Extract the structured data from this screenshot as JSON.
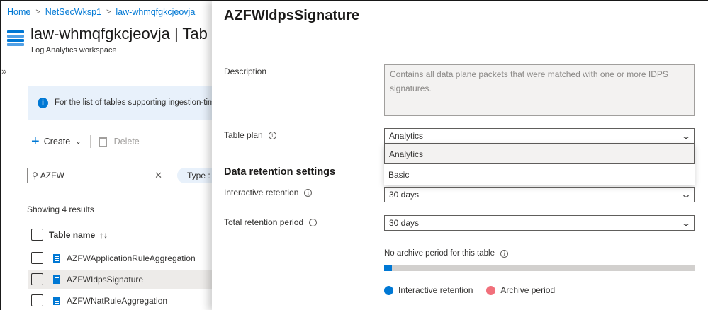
{
  "breadcrumb": {
    "items": [
      "Home",
      "NetSecWksp1",
      "law-whmqfgkcjeovja"
    ],
    "separator": ">"
  },
  "workspace": {
    "title": "law-whmqfgkcjeovja | Tab",
    "subtitle": "Log Analytics workspace",
    "icon": "log-analytics-icon"
  },
  "collapse_glyph": "»",
  "info_banner": {
    "text": "For the list of tables supporting ingestion-time",
    "icon": "info-icon"
  },
  "toolbar": {
    "create_label": "Create",
    "delete_label": "Delete"
  },
  "search": {
    "value": "AZFW",
    "type_filter": "Type :"
  },
  "results": {
    "count_text": "Showing 4 results",
    "column_header": "Table name",
    "sort_glyph": "↑↓",
    "rows": [
      {
        "name": "AZFWApplicationRuleAggregation",
        "selected": false
      },
      {
        "name": "AZFWIdpsSignature",
        "selected": true
      },
      {
        "name": "AZFWNatRuleAggregation",
        "selected": false
      }
    ]
  },
  "panel": {
    "title": "AZFWIdpsSignature",
    "description_label": "Description",
    "description_text": "Contains all data plane packets that were matched with one or more IDPS signatures.",
    "table_plan_label": "Table plan",
    "table_plan_value": "Analytics",
    "table_plan_options": [
      "Analytics",
      "Basic"
    ],
    "retention_heading": "Data retention settings",
    "interactive_label": "Interactive retention",
    "interactive_value": "30 days",
    "total_label": "Total retention period",
    "total_value": "30 days",
    "archive_note": "No archive period for this table",
    "retention_bar_fraction": 0.025,
    "legend": [
      {
        "label": "Interactive retention",
        "color": "#0078d4"
      },
      {
        "label": "Archive period",
        "color": "#f1707b"
      }
    ]
  },
  "colors": {
    "accent": "#0078d4",
    "archive": "#f1707b",
    "info_bg": "#e8f1fb"
  }
}
